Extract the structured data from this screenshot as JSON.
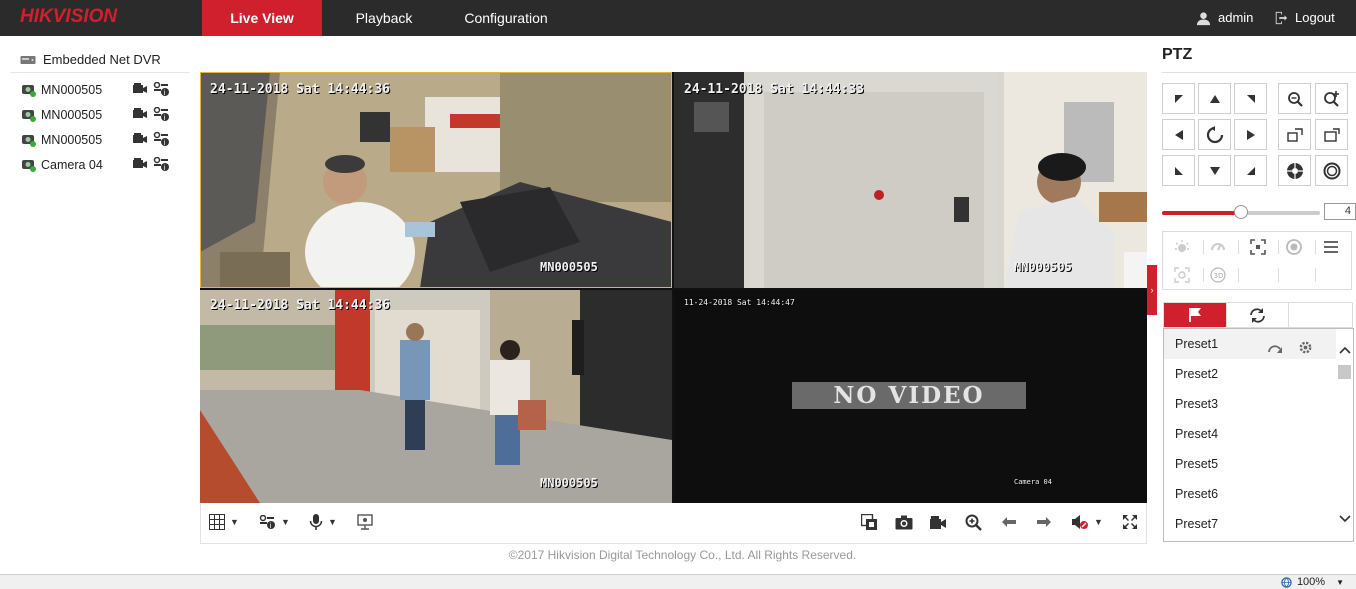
{
  "header": {
    "logo": "HIKVISION",
    "tabs": [
      {
        "label": "Live View",
        "active": true
      },
      {
        "label": "Playback",
        "active": false
      },
      {
        "label": "Configuration",
        "active": false
      }
    ],
    "user": "admin",
    "logout": "Logout",
    "accent_color": "#d0202e"
  },
  "sidebar": {
    "root": "Embedded Net DVR",
    "cameras": [
      {
        "label": "MN000505"
      },
      {
        "label": "MN000505"
      },
      {
        "label": "MN000505"
      },
      {
        "label": "Camera 04"
      }
    ]
  },
  "video": {
    "tiles": [
      {
        "timestamp": "24-11-2018 Sat 14:44:36",
        "name": "MN000505",
        "selected": true
      },
      {
        "timestamp": "24-11-2018 Sat 14:44:33",
        "name": "MN000505",
        "selected": false
      },
      {
        "timestamp": "24-11-2018 Sat 14:44:36",
        "name": "MN000505",
        "selected": false
      },
      {
        "timestamp": "11-24-2018 Sat 14:44:47",
        "name": "Camera 04",
        "no_video": "NO VIDEO",
        "selected": false
      }
    ]
  },
  "toolbar": {
    "left_icons": [
      "window-division-icon",
      "stream-type-icon",
      "microphone-icon",
      "digital-zoom-icon"
    ],
    "right_icons": [
      "stop-all-icon",
      "capture-icon",
      "record-icon",
      "zoom-in-icon",
      "previous-page-icon",
      "next-page-icon",
      "mute-icon",
      "fullscreen-icon"
    ]
  },
  "footer": "©2017 Hikvision Digital Technology Co., Ltd. All Rights Reserved.",
  "ptz": {
    "title": "PTZ",
    "speed": "4",
    "speed_fraction": 0.5,
    "presets": [
      "Preset1",
      "Preset2",
      "Preset3",
      "Preset4",
      "Preset5",
      "Preset6",
      "Preset7"
    ]
  },
  "status": {
    "zoom": "100%"
  }
}
